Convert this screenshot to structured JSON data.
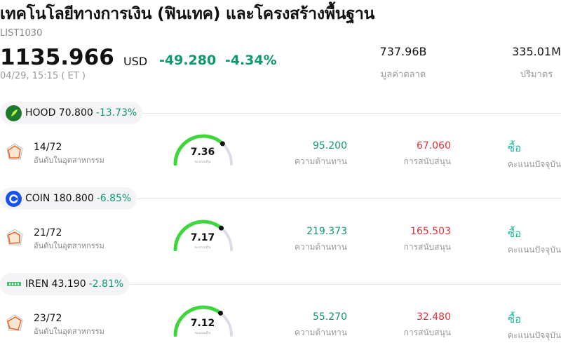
{
  "header": {
    "title": "เทคโนโลยีทางการเงิน (ฟินเทค) และโครงสร้างพื้นฐาน",
    "code": "LIST1030",
    "price": "1135.966",
    "currency": "USD",
    "change": "-49.280",
    "change_pct": "-4.34%",
    "time": "04/29, 15:15 ( ET )",
    "market_cap_value": "737.96B",
    "market_cap_label": "มูลค่าตลาด",
    "volume_value": "335.01M",
    "volume_label": "ปริมาตร"
  },
  "labels": {
    "rank_label": "อันดับในอุตสาหกรรม",
    "gauge_caption": "คะแนนหุ้น",
    "resistance_label": "ความต้านทาน",
    "support_label": "การสนับสนุน",
    "signal_label": "คะแนนปัจจุบัน"
  },
  "colors": {
    "up": "#0d9a6e",
    "down": "#e0303a",
    "gauge_fill": "#3ed63b",
    "gauge_track": "#dcdce6",
    "buy": "#1fb89b"
  },
  "stocks": [
    {
      "ticker_price": "HOOD 70.800",
      "change_pct": "-13.73%",
      "logo_icon": "robinhood-feather-icon",
      "rank": "14/72",
      "score": "7.36",
      "score_fraction": 0.74,
      "resistance": "95.200",
      "support": "67.060",
      "signal": "ซื้อ"
    },
    {
      "ticker_price": "COIN 180.800",
      "change_pct": "-6.85%",
      "logo_icon": "coinbase-c-icon",
      "rank": "21/72",
      "score": "7.17",
      "score_fraction": 0.72,
      "resistance": "219.373",
      "support": "165.503",
      "signal": "ซื้อ"
    },
    {
      "ticker_price": "IREN 43.190",
      "change_pct": "-2.81%",
      "logo_icon": "iren-logo-icon",
      "rank": "23/72",
      "score": "7.12",
      "score_fraction": 0.71,
      "resistance": "55.270",
      "support": "32.480",
      "signal": "ซื้อ"
    }
  ]
}
